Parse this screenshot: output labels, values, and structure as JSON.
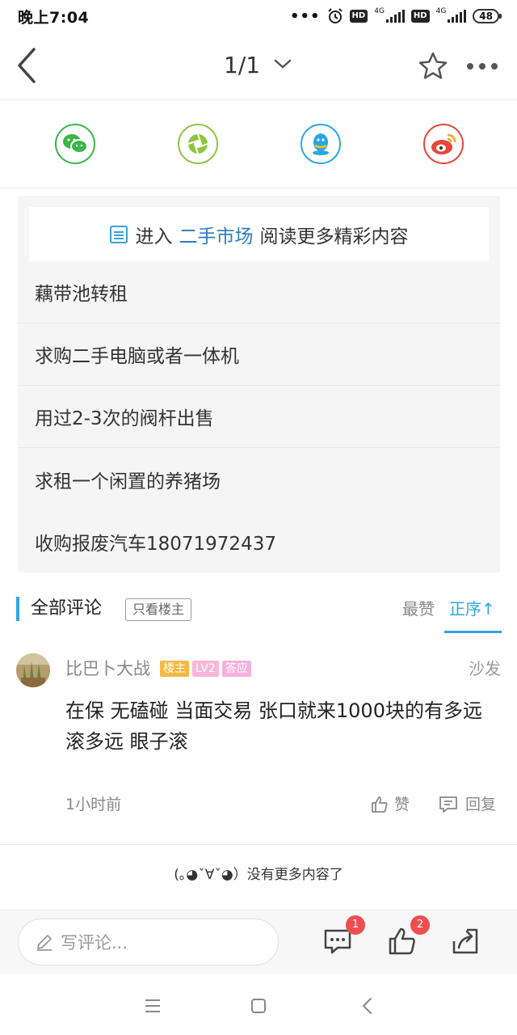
{
  "status_bar": {
    "time": "晚上7:04",
    "dots": "•••",
    "hd1": "HD",
    "net1": "4G",
    "hd2": "HD",
    "net2": "4G",
    "battery": "48"
  },
  "header": {
    "page_indicator": "1/1"
  },
  "share": {
    "items": [
      "wechat-icon",
      "moments-icon",
      "qq-icon",
      "weibo-icon"
    ]
  },
  "market": {
    "banner_prefix": "进入",
    "banner_link": "二手市场",
    "banner_suffix": "阅读更多精彩内容",
    "items": [
      "藕带池转租",
      "求购二手电脑或者一体机",
      "用过2-3次的阀杆出售",
      "求租一个闲置的养猪场",
      "收购报废汽车18071972437"
    ]
  },
  "comments_header": {
    "title": "全部评论",
    "filter_label": "只看楼主",
    "sort_likes": "最赞",
    "sort_order": "正序↑"
  },
  "comment": {
    "user_name": "比巴卜大战",
    "badge_owner": "楼主",
    "badge_level": "LV2",
    "badge_answer": "答应",
    "floor": "沙发",
    "text": "在保 无磕碰 当面交易 张口就来1000块的有多远滚多远 眼子滚",
    "time": "1小时前",
    "like_label": "赞",
    "reply_label": "回复"
  },
  "no_more_text": "(｡◕ˇ∀ˇ◕）没有更多内容了",
  "action_bar": {
    "input_placeholder": "写评论...",
    "comment_count": "1",
    "like_count": "2"
  },
  "colors": {
    "accent": "#2ea7e0",
    "link": "#2f7bbf",
    "badge_red": "#f04e4e",
    "owner_badge": "#f4b942"
  }
}
